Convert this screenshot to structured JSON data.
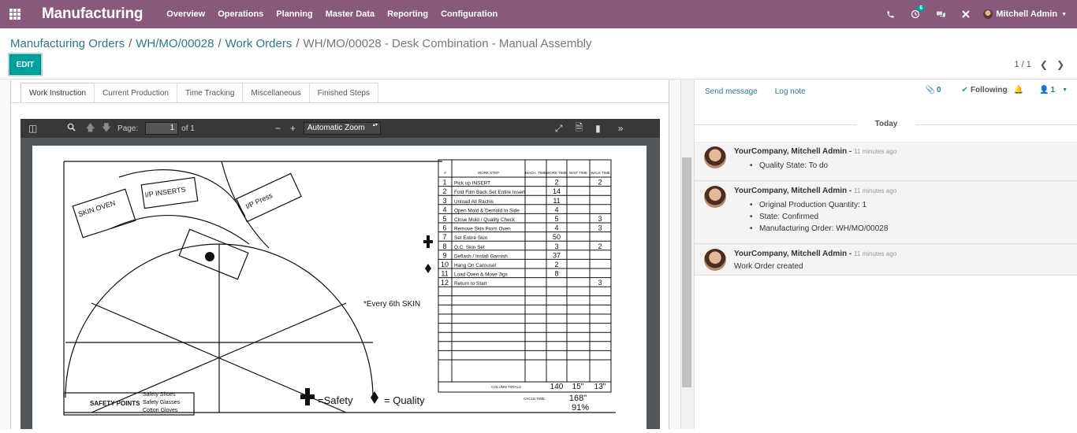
{
  "app": {
    "brand": "Manufacturing"
  },
  "menu": [
    "Overview",
    "Operations",
    "Planning",
    "Master Data",
    "Reporting",
    "Configuration"
  ],
  "systray": {
    "activity_count": "6",
    "user": "Mitchell Admin"
  },
  "breadcrumb": [
    {
      "label": "Manufacturing Orders"
    },
    {
      "label": "WH/MO/00028"
    },
    {
      "label": "Work Orders"
    },
    {
      "label": "WH/MO/00028 - Desk Combination - Manual Assembly"
    }
  ],
  "edit_label": "EDIT",
  "pager": {
    "value": "1 / 1"
  },
  "tabs": [
    "Work Instruction",
    "Current Production",
    "Time Tracking",
    "Miscellaneous",
    "Finished Steps"
  ],
  "viewer": {
    "page_label": "Page:",
    "page_value": "1",
    "of_label": "of 1",
    "zoom": "Automatic Zoom"
  },
  "worksheet": {
    "sketch_labels": [
      "SKIN OVEN",
      "I/P INSERTS",
      "I/P Press"
    ],
    "headers": [
      "#",
      "WORK STEP",
      "MACH. TIME",
      "WORK TIME",
      "WAIT TIME",
      "WALK TIME"
    ],
    "rows": [
      {
        "n": "1",
        "step": "Pick up INSERT",
        "work": "2",
        "walk": "2"
      },
      {
        "n": "2",
        "step": "Fold Film Back Set Entire Insert",
        "work": "14",
        "walk": ""
      },
      {
        "n": "3",
        "step": "Unload All Rachis",
        "work": "11",
        "walk": ""
      },
      {
        "n": "4",
        "step": "Open Mold & Demold In Side",
        "work": "4",
        "walk": ""
      },
      {
        "n": "5",
        "step": "Close Mold / Quality Check",
        "work": "5",
        "walk": "3"
      },
      {
        "n": "6",
        "step": "Remove Skin From Oven",
        "work": "4",
        "walk": "3"
      },
      {
        "n": "7",
        "step": "Set Entire Skin",
        "work": "50",
        "walk": ""
      },
      {
        "n": "8",
        "step": "Q.C. Skin Set",
        "work": "3",
        "walk": "2"
      },
      {
        "n": "9",
        "step": "Deflash / Install Garnish",
        "work": "37",
        "walk": ""
      },
      {
        "n": "10",
        "step": "Hang On Carousel",
        "work": "2",
        "walk": ""
      },
      {
        "n": "11",
        "step": "Load Oven & Move Jigs",
        "work": "8",
        "walk": ""
      },
      {
        "n": "12",
        "step": "Return to Start",
        "work": "",
        "walk": "3"
      }
    ],
    "column_totals_label": "COLUMN TOTALS",
    "totals": [
      "140",
      "15\"",
      "13\""
    ],
    "cycle_time_label": "CYCLE TIME",
    "cycle_time": "168\"",
    "cycle_pct": "91%",
    "note": "*Every 6th SKIN",
    "safety_points": "SAFETY POINTS",
    "safety_items": [
      "Safety Shoes",
      "Safety Glasses",
      "Cotton Gloves"
    ],
    "legend_safety": "=Safety",
    "legend_quality": "= Quality"
  },
  "chatter": {
    "send_message": "Send message",
    "log_note": "Log note",
    "attachments": "0",
    "following": "Following",
    "followers": "1",
    "today": "Today",
    "messages": [
      {
        "author": "YourCompany, Mitchell Admin",
        "date": "11 minutes ago",
        "items": [
          "Quality State: To do"
        ],
        "text": ""
      },
      {
        "author": "YourCompany, Mitchell Admin",
        "date": "11 minutes ago",
        "items": [
          "Original Production Quantity: 1",
          "State: Confirmed",
          "Manufacturing Order: WH/MO/00028"
        ],
        "text": ""
      },
      {
        "author": "YourCompany, Mitchell Admin",
        "date": "11 minutes ago",
        "items": [],
        "text": "Work Order created"
      }
    ]
  }
}
